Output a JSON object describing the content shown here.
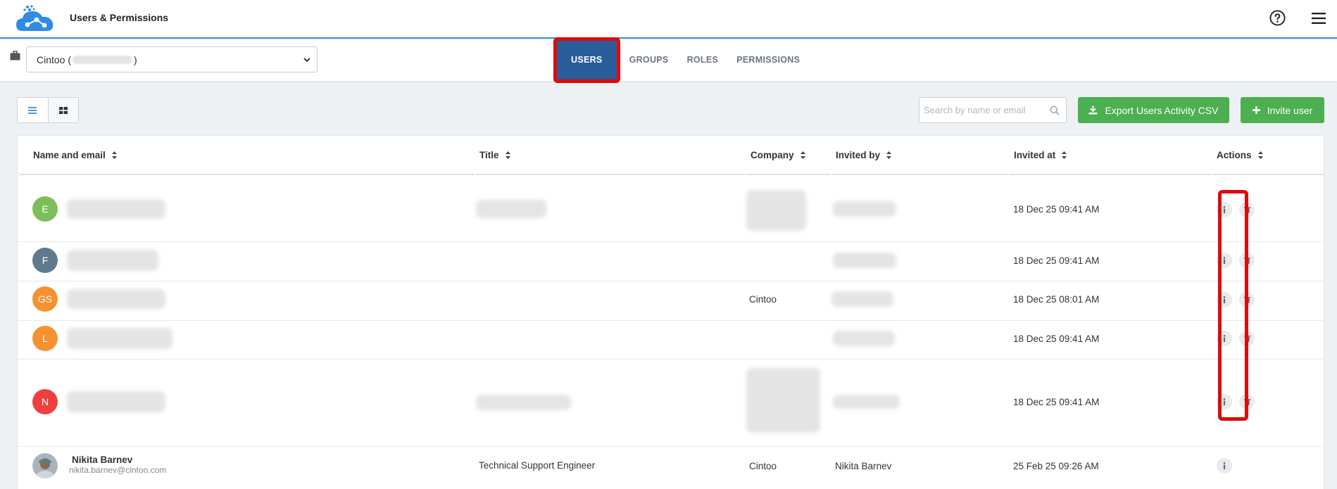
{
  "header": {
    "title": "Users & Permissions"
  },
  "org_selector": {
    "prefix": "Cintoo (",
    "suffix": ")"
  },
  "tabs": [
    {
      "label": "USERS",
      "active": true
    },
    {
      "label": "GROUPS",
      "active": false
    },
    {
      "label": "ROLES",
      "active": false
    },
    {
      "label": "PERMISSIONS",
      "active": false
    }
  ],
  "toolbar": {
    "search_placeholder": "Search by name or email",
    "export_label": "Export Users Activity CSV",
    "invite_label": "Invite user"
  },
  "colors": {
    "accent": "#2a5d9b",
    "green": "#4caf50",
    "highlight": "#e00a0a"
  },
  "table": {
    "columns": [
      "Name and email",
      "Title",
      "Company",
      "Invited by",
      "Invited at",
      "Actions"
    ],
    "rows": [
      {
        "initials": "E",
        "avatar_color": "#7cbf5a",
        "company": "",
        "invited_at": "18 Dec 25 09:41 AM"
      },
      {
        "initials": "F",
        "avatar_color": "#5f7a8c",
        "company": "",
        "invited_at": "18 Dec 25 09:41 AM"
      },
      {
        "initials": "GS",
        "avatar_color": "#f5922f",
        "company": "Cintoo",
        "invited_at": "18 Dec 25 08:01 AM"
      },
      {
        "initials": "L",
        "avatar_color": "#f5922f",
        "company": "",
        "invited_at": "18 Dec 25 09:41 AM"
      },
      {
        "initials": "N",
        "avatar_color": "#ef3f3f",
        "company": "",
        "invited_at": "18 Dec 25 09:41 AM"
      },
      {
        "name": "Nikita Barnev",
        "email": "nikita.barnev@cintoo.com",
        "title": "Technical Support Engineer",
        "company": "Cintoo",
        "invited_by": "Nikita Barnev",
        "invited_at": "25 Feb 25 09:26 AM"
      }
    ]
  }
}
